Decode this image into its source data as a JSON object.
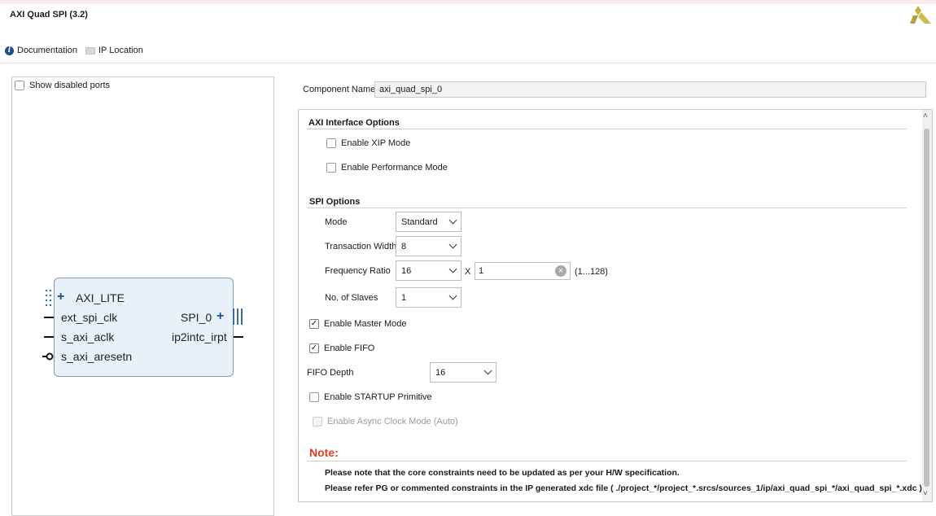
{
  "window": {
    "title": "AXI Quad SPI (3.2)"
  },
  "toolbar": {
    "documentation": "Documentation",
    "ip_location": "IP Location"
  },
  "left": {
    "show_disabled_ports": "Show disabled ports",
    "block": {
      "left_ports": [
        "AXI_LITE",
        "ext_spi_clk",
        "s_axi_aclk",
        "s_axi_aresetn"
      ],
      "right_ports": [
        "SPI_0",
        "ip2intc_irpt"
      ]
    }
  },
  "component": {
    "label": "Component Name",
    "value": "axi_quad_spi_0"
  },
  "axi": {
    "header": "AXI Interface Options",
    "xip": "Enable XIP Mode",
    "perf": "Enable Performance Mode"
  },
  "spi": {
    "header": "SPI Options",
    "mode_label": "Mode",
    "mode_value": "Standard",
    "tw_label": "Transaction Width",
    "tw_value": "8",
    "fr_label": "Frequency Ratio",
    "fr_value": "16",
    "fr_x": "X",
    "fr_mult": "1",
    "fr_range": "(1...128)",
    "slaves_label": "No. of Slaves",
    "slaves_value": "1",
    "master": "Enable Master Mode",
    "fifo": "Enable FIFO",
    "fifo_depth_label": "FIFO Depth",
    "fifo_depth_value": "16",
    "startup": "Enable STARTUP Primitive",
    "async": "Enable Async Clock Mode (Auto)"
  },
  "note": {
    "title": "Note:",
    "line1": "Please note that the core constraints need to be updated as per your H/W specification.",
    "line2": "Please refer PG or commented constraints in the IP generated xdc file ( ./project_*/project_*.srcs/sources_1/ip/axi_quad_spi_*/axi_quad_spi_*.xdc )."
  }
}
